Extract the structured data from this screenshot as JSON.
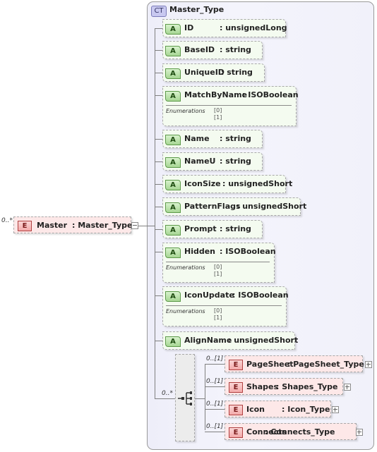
{
  "complex_type": {
    "badge": "CT",
    "name": "Master_Type"
  },
  "root_element": {
    "badge": "E",
    "name": "Master",
    "type": ": Master_Type",
    "cardinality": "0..*"
  },
  "enum_label": "Enumerations",
  "attributes": [
    {
      "badge": "A",
      "name": "ID",
      "type": ": unsignedLong"
    },
    {
      "badge": "A",
      "name": "BaseID",
      "type": ": string"
    },
    {
      "badge": "A",
      "name": "UniqueID",
      "type": ": string"
    },
    {
      "badge": "A",
      "name": "MatchByName",
      "type": ": ISOBoolean",
      "enums": [
        "[0]",
        "[1]"
      ]
    },
    {
      "badge": "A",
      "name": "Name",
      "type": ": string"
    },
    {
      "badge": "A",
      "name": "NameU",
      "type": ": string"
    },
    {
      "badge": "A",
      "name": "IconSize",
      "type": ": unsignedShort"
    },
    {
      "badge": "A",
      "name": "PatternFlags",
      "type": ": unsignedShort"
    },
    {
      "badge": "A",
      "name": "Prompt",
      "type": ": string"
    },
    {
      "badge": "A",
      "name": "Hidden",
      "type": ": ISOBoolean",
      "enums": [
        "[0]",
        "[1]"
      ]
    },
    {
      "badge": "A",
      "name": "IconUpdate",
      "type": ": ISOBoolean",
      "enums": [
        "[0]",
        "[1]"
      ]
    },
    {
      "badge": "A",
      "name": "AlignName",
      "type": ": unsignedShort"
    }
  ],
  "sequence": {
    "cardinality": "0..*"
  },
  "child_elements": [
    {
      "badge": "E",
      "name": "PageSheet",
      "type": ": PageSheet_Type",
      "cardinality": "0..[1]"
    },
    {
      "badge": "E",
      "name": "Shapes",
      "type": ": Shapes_Type",
      "cardinality": "0..[1]"
    },
    {
      "badge": "E",
      "name": "Icon",
      "type": ": Icon_Type",
      "cardinality": "0..[1]"
    },
    {
      "badge": "E",
      "name": "Connects",
      "type": ": Connects_Type",
      "cardinality": "0..[1]"
    }
  ]
}
